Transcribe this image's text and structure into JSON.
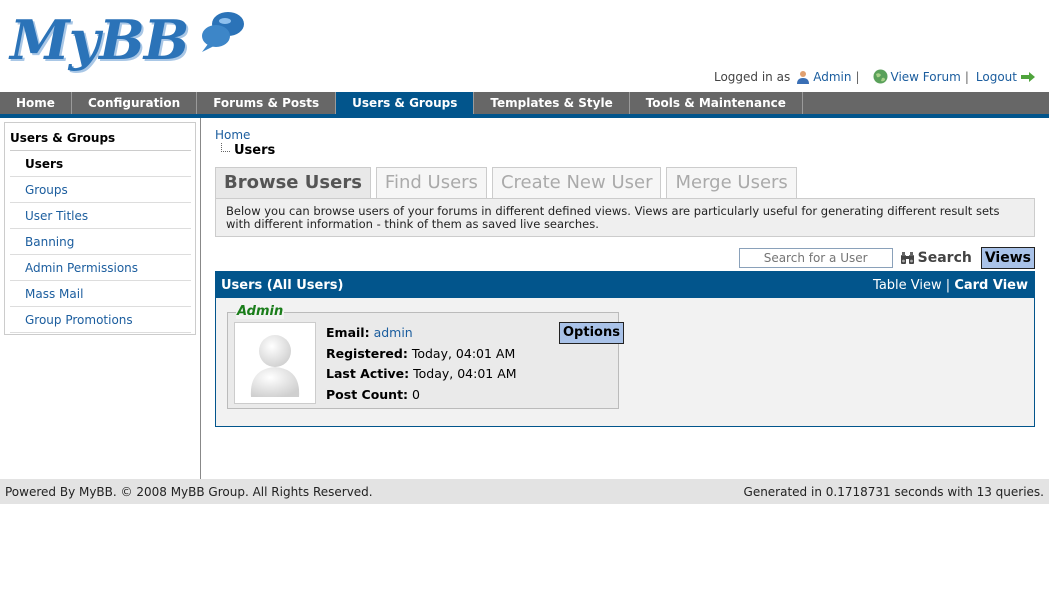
{
  "header": {
    "logo_text": "MyBB",
    "welcome": {
      "logged_in_as": "Logged in as",
      "user": "Admin",
      "sep1": "|",
      "view_forum": "View Forum",
      "sep2": "|",
      "logout": "Logout"
    }
  },
  "menu": {
    "items": [
      "Home",
      "Configuration",
      "Forums & Posts",
      "Users & Groups",
      "Templates & Style",
      "Tools & Maintenance"
    ],
    "active": "Users & Groups"
  },
  "sidebar": {
    "title": "Users & Groups",
    "items": [
      "Users",
      "Groups",
      "User Titles",
      "Banning",
      "Admin Permissions",
      "Mass Mail",
      "Group Promotions"
    ]
  },
  "breadcrumb": {
    "home": "Home",
    "current": "Users"
  },
  "tabs": [
    "Browse Users",
    "Find Users",
    "Create New User",
    "Merge Users"
  ],
  "description": "Below you can browse users of your forums in different defined views. Views are particularly useful for generating different result sets with different information - think of them as saved live searches.",
  "search": {
    "placeholder": "Search for a User",
    "button": "Search",
    "views": "Views"
  },
  "panel": {
    "title": "Users (All Users)",
    "table_view": "Table View",
    "divider": "|",
    "card_view": "Card View"
  },
  "user_card": {
    "name": "Admin",
    "email_label": "Email:",
    "email_value": "admin",
    "registered_label": "Registered:",
    "registered_value": "Today, 04:01 AM",
    "last_active_label": "Last Active:",
    "last_active_value": "Today, 04:01 AM",
    "post_count_label": "Post Count:",
    "post_count_value": "0",
    "options": "Options"
  },
  "footer": {
    "left": "Powered By MyBB. © 2008 MyBB Group. All Rights Reserved.",
    "right": "Generated in 0.1718731 seconds with 13 queries."
  },
  "colors": {
    "brand_blue": "#02558c",
    "menu_gray": "#676767",
    "link_blue": "#1b5d9e",
    "button_blue": "#a9c2e8",
    "username_green": "#1a7d1a"
  }
}
